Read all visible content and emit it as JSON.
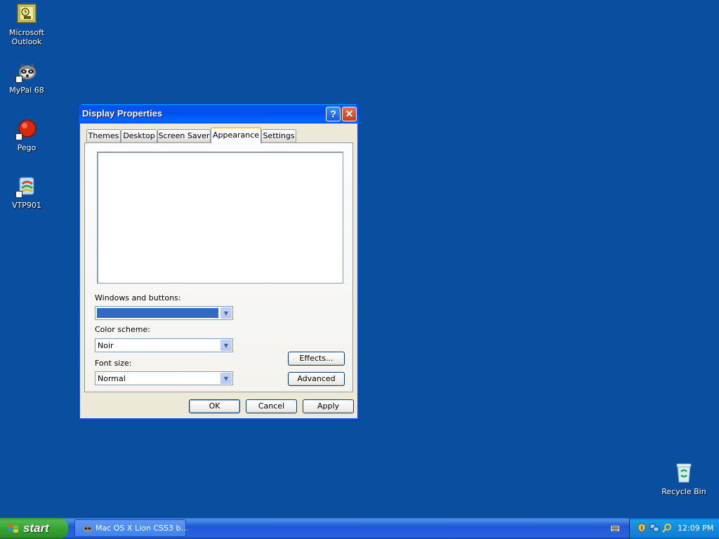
{
  "desktop": {
    "icons": [
      {
        "label": "Microsoft Outlook"
      },
      {
        "label": "MyPal 68"
      },
      {
        "label": "Pego"
      },
      {
        "label": "VTP901"
      },
      {
        "label": "Recycle Bin"
      }
    ]
  },
  "window": {
    "title": "Display Properties",
    "help_glyph": "?",
    "close_glyph": "✕",
    "tabs": [
      {
        "label": "Themes"
      },
      {
        "label": "Desktop"
      },
      {
        "label": "Screen Saver"
      },
      {
        "label": "Appearance"
      },
      {
        "label": "Settings"
      }
    ],
    "active_tab": "Appearance",
    "windows_buttons_label": "Windows and buttons:",
    "windows_buttons_value": "",
    "color_scheme_label": "Color scheme:",
    "color_scheme_value": "Noir",
    "font_size_label": "Font size:",
    "font_size_value": "Normal",
    "effects_label": "Effects...",
    "advanced_label": "Advanced",
    "ok_label": "OK",
    "cancel_label": "Cancel",
    "apply_label": "Apply"
  },
  "taskbar": {
    "start_label": "start",
    "task_label": "Mac OS X Lion CSS3 b...",
    "clock": "12:09 PM"
  },
  "colors": {
    "desktop": "#0a4ea0",
    "selection": "#316ac5"
  }
}
